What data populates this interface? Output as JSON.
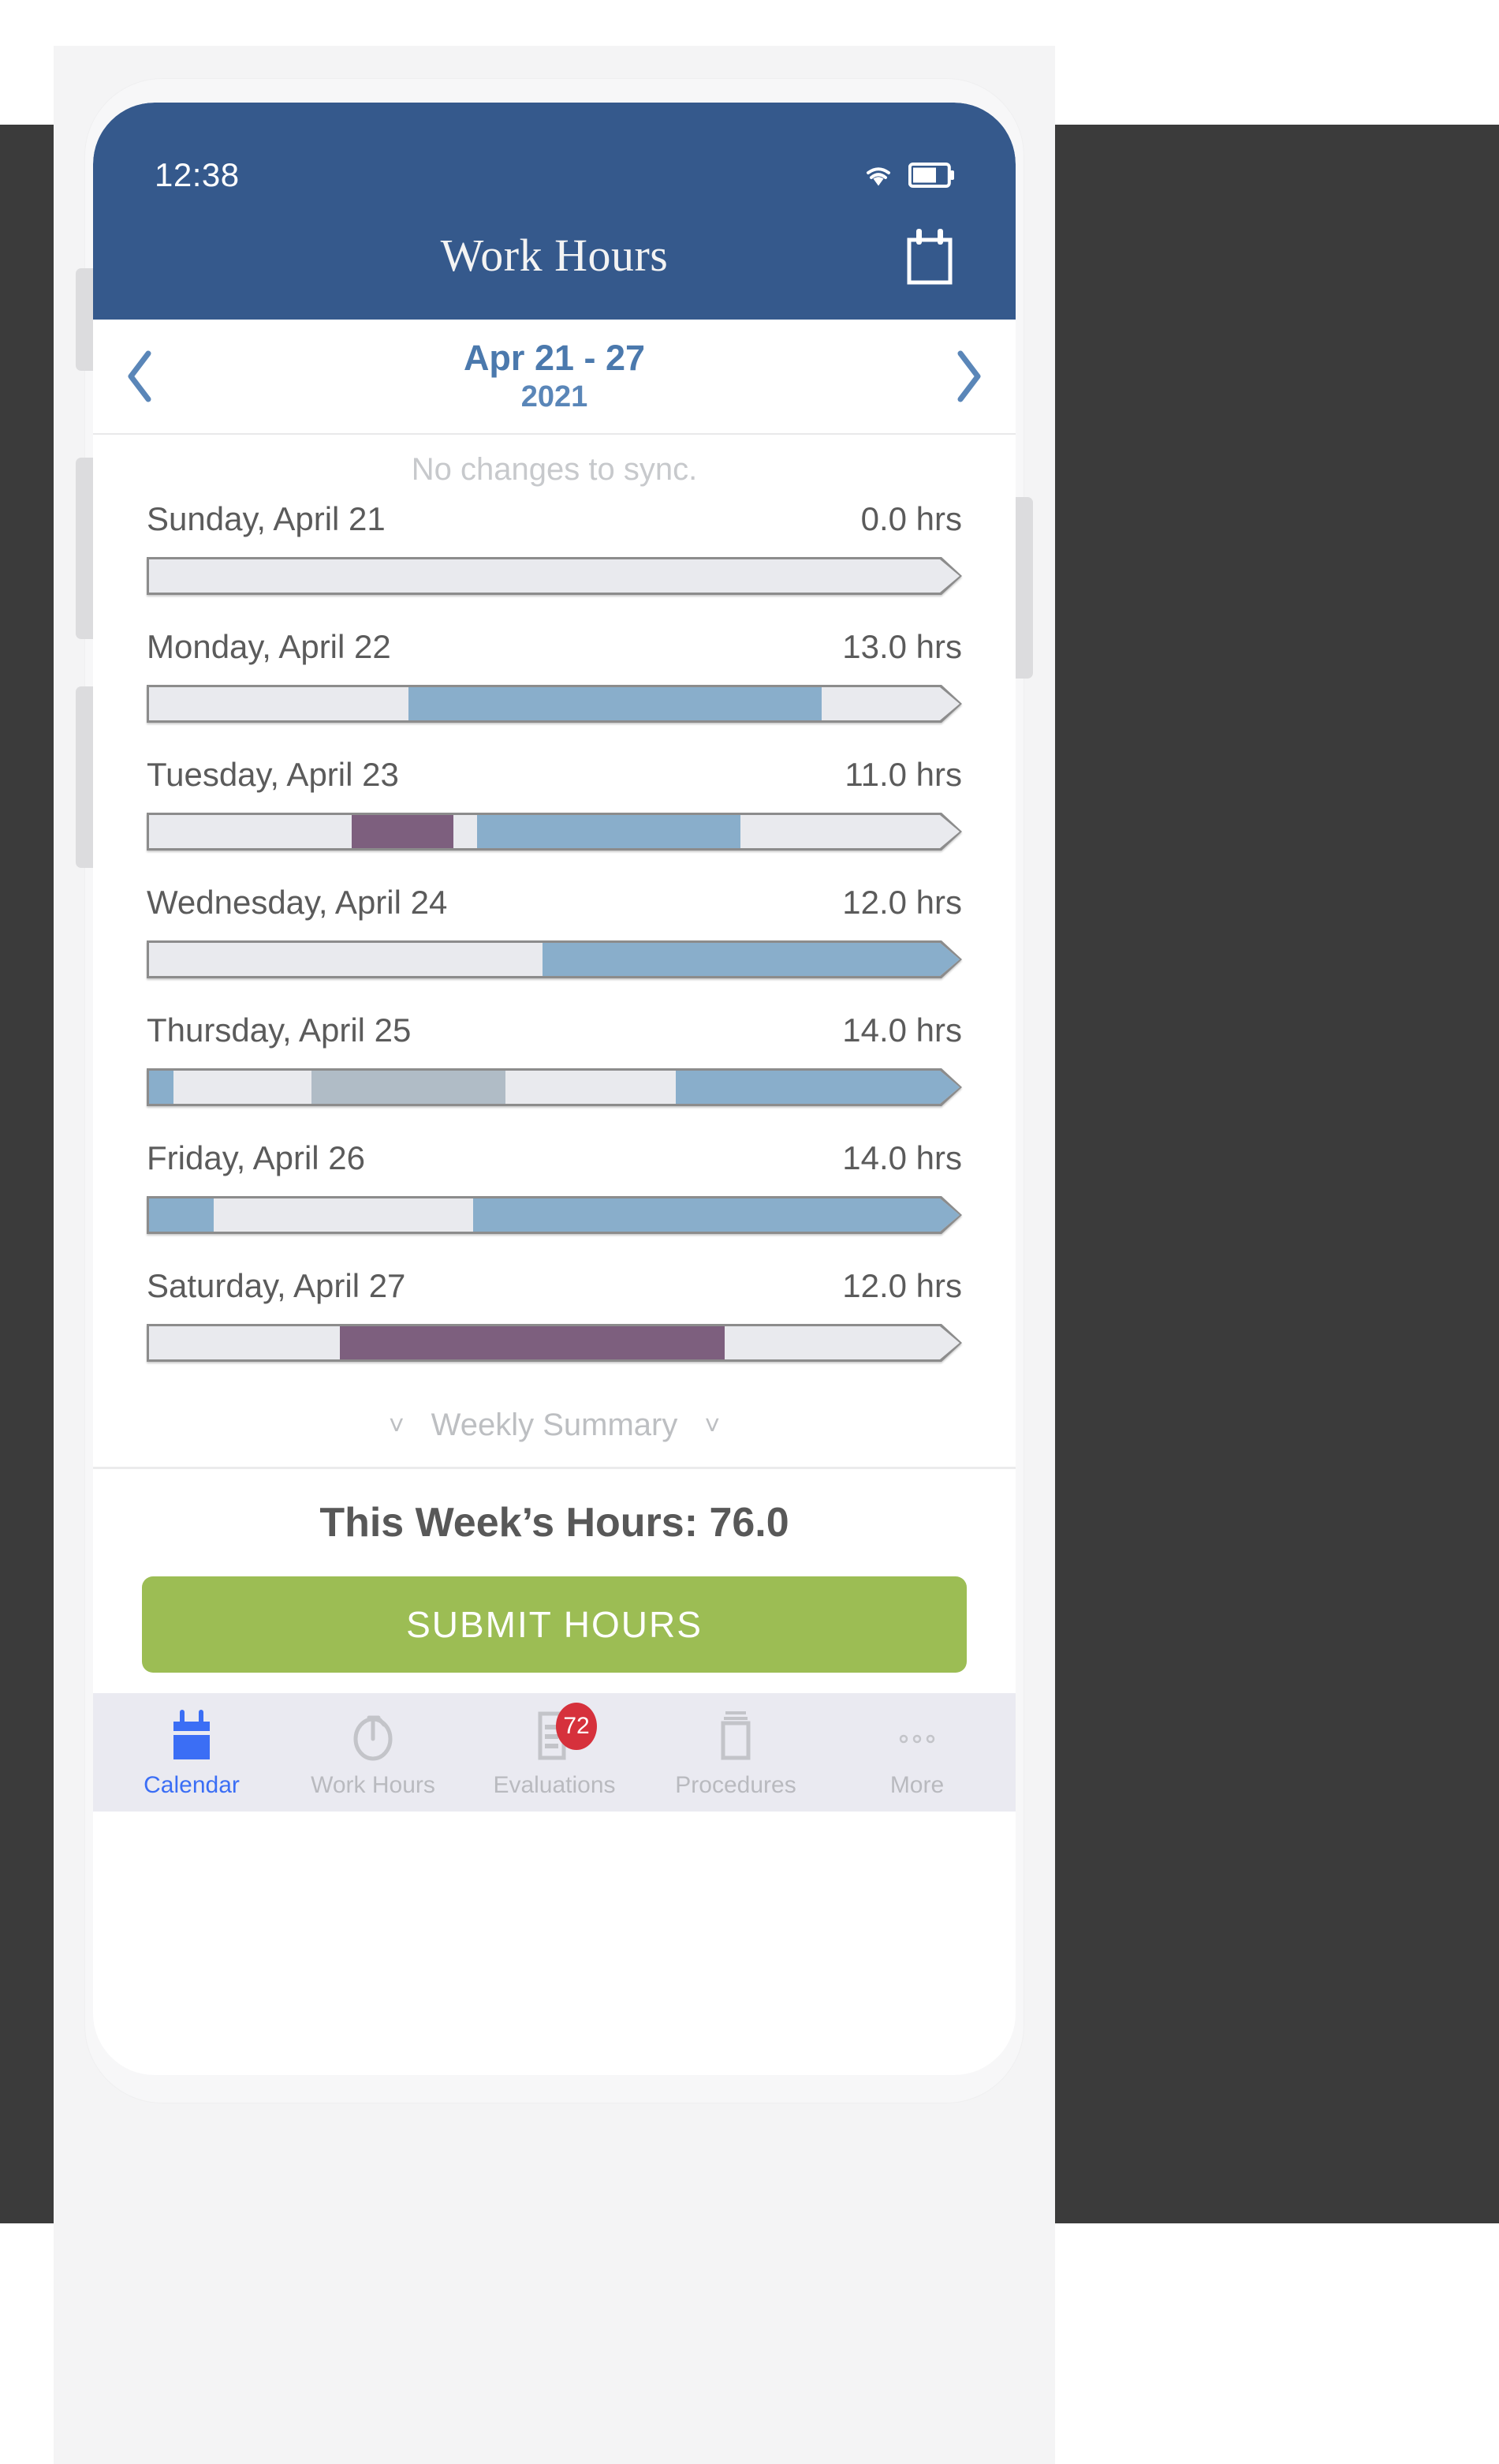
{
  "statusbar": {
    "time": "12:38",
    "wifi_icon": "wifi-icon",
    "battery_icon": "battery-icon"
  },
  "navbar": {
    "title": "Work Hours",
    "calendar_icon": "calendar-icon"
  },
  "week_selector": {
    "prev_icon": "chevron-left-icon",
    "next_icon": "chevron-right-icon",
    "range": "Apr 21 - 27",
    "year": "2021"
  },
  "sync_status": "No changes to sync.",
  "colors": {
    "nav_blue": "#35598c",
    "accent_blue": "#4b79ad",
    "bar_blue": "#89aecb",
    "bar_purple": "#7d5f7e",
    "bar_gray": "#b0bcc6",
    "bar_empty": "#e9eaee",
    "submit_green": "#9cbd54",
    "badge_red": "#d6313c",
    "tab_active_blue": "#3b6ef5"
  },
  "days": [
    {
      "name": "Sunday, April 21",
      "hours": "0.0 hrs",
      "segments": []
    },
    {
      "name": "Monday, April 22",
      "hours": "13.0 hrs",
      "segments": [
        {
          "start": 32.0,
          "width": 51.0,
          "color": "#89aecb"
        }
      ]
    },
    {
      "name": "Tuesday, April 23",
      "hours": "11.0 hrs",
      "segments": [
        {
          "start": 25.0,
          "width": 12.5,
          "color": "#7d5f7e"
        },
        {
          "start": 40.5,
          "width": 32.5,
          "color": "#89aecb"
        }
      ]
    },
    {
      "name": "Wednesday, April 24",
      "hours": "12.0 hrs",
      "segments": [
        {
          "start": 48.5,
          "width": 51.5,
          "color": "#89aecb"
        }
      ]
    },
    {
      "name": "Thursday, April 25",
      "hours": "14.0 hrs",
      "segments": [
        {
          "start": 0.0,
          "width": 3.0,
          "color": "#89aecb"
        },
        {
          "start": 20.0,
          "width": 24.0,
          "color": "#b0bcc6"
        },
        {
          "start": 65.0,
          "width": 35.0,
          "color": "#89aecb"
        }
      ]
    },
    {
      "name": "Friday, April 26",
      "hours": "14.0 hrs",
      "segments": [
        {
          "start": 0.0,
          "width": 8.0,
          "color": "#89aecb"
        },
        {
          "start": 40.0,
          "width": 60.0,
          "color": "#89aecb"
        }
      ]
    },
    {
      "name": "Saturday, April 27",
      "hours": "12.0 hrs",
      "segments": [
        {
          "start": 23.5,
          "width": 47.5,
          "color": "#7d5f7e"
        }
      ]
    }
  ],
  "weekly_summary": {
    "label": "Weekly Summary",
    "left_chevron": "chevron-down-icon",
    "right_chevron": "chevron-down-icon"
  },
  "footer": {
    "week_total": "This Week’s Hours: 76.0",
    "submit_label": "SUBMIT HOURS"
  },
  "tabbar": {
    "items": [
      {
        "label": "Calendar",
        "icon": "calendar-icon",
        "active": true,
        "badge": null
      },
      {
        "label": "Work Hours",
        "icon": "clock-icon",
        "active": false,
        "badge": null
      },
      {
        "label": "Evaluations",
        "icon": "document-icon",
        "active": false,
        "badge": "72"
      },
      {
        "label": "Procedures",
        "icon": "list-icon",
        "active": false,
        "badge": null
      },
      {
        "label": "More",
        "icon": "ellipsis-icon",
        "active": false,
        "badge": null
      }
    ]
  }
}
